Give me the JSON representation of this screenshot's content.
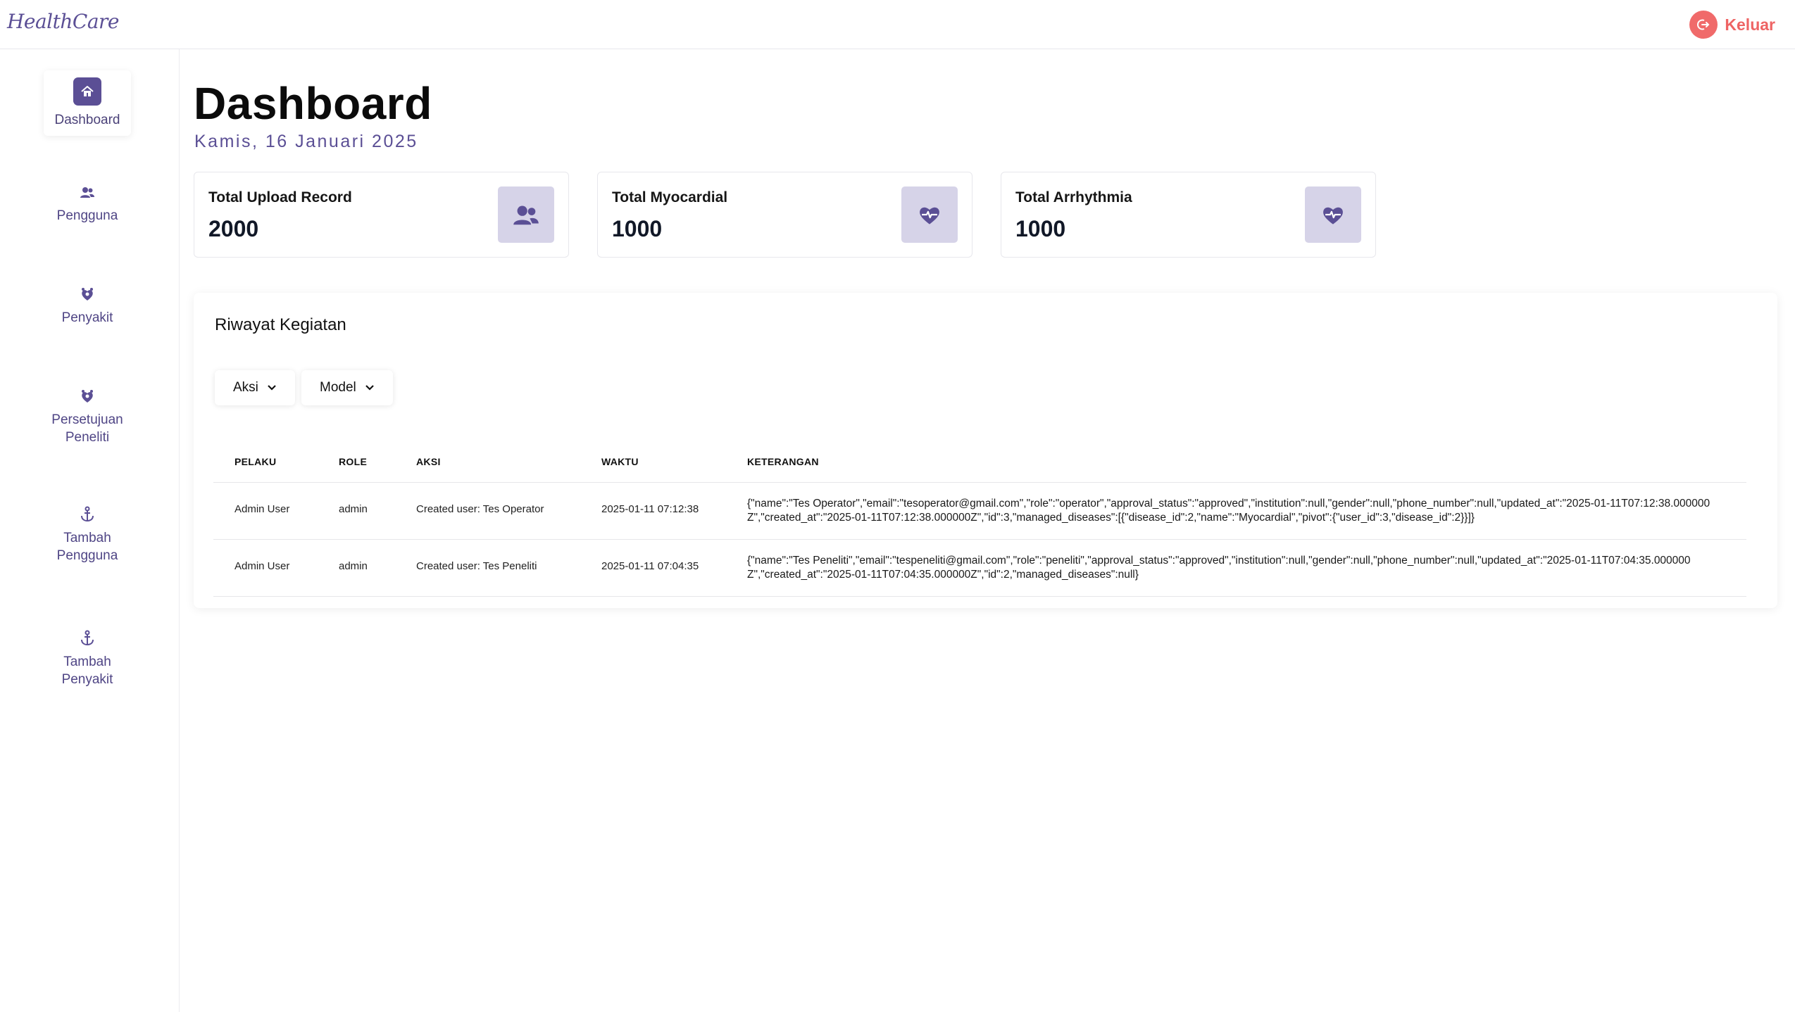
{
  "app": {
    "logo": "HealthCare",
    "logout_label": "Keluar"
  },
  "sidebar": {
    "items": [
      {
        "label": "Dashboard",
        "icon": "home-icon",
        "active": true
      },
      {
        "label": "Pengguna",
        "icon": "users-icon",
        "active": false
      },
      {
        "label": "Penyakit",
        "icon": "disease-icon",
        "active": false
      },
      {
        "label": "Persetujuan Peneliti",
        "icon": "disease-icon",
        "active": false
      },
      {
        "label": "Tambah Pengguna",
        "icon": "anchor-icon",
        "active": false
      },
      {
        "label": "Tambah Penyakit",
        "icon": "anchor-icon",
        "active": false
      }
    ]
  },
  "header": {
    "title": "Dashboard",
    "date": "Kamis, 16 Januari 2025"
  },
  "stats": [
    {
      "label": "Total Upload Record",
      "value": "2000",
      "icon": "users-icon"
    },
    {
      "label": "Total Myocardial",
      "value": "1000",
      "icon": "heart-pulse-icon"
    },
    {
      "label": "Total Arrhythmia",
      "value": "1000",
      "icon": "heart-pulse-icon"
    }
  ],
  "activity": {
    "title": "Riwayat Kegiatan",
    "filters": [
      {
        "label": "Aksi"
      },
      {
        "label": "Model"
      }
    ],
    "columns": [
      "PELAKU",
      "ROLE",
      "AKSI",
      "WAKTU",
      "KETERANGAN"
    ],
    "rows": [
      {
        "pelaku": "Admin User",
        "role": "admin",
        "aksi": "Created user: Tes Operator",
        "waktu": "2025-01-11 07:12:38",
        "keterangan": "{\"name\":\"Tes Operator\",\"email\":\"tesoperator@gmail.com\",\"role\":\"operator\",\"approval_status\":\"approved\",\"institution\":null,\"gender\":null,\"phone_number\":null,\"updated_at\":\"2025-01-11T07:12:38.000000Z\",\"created_at\":\"2025-01-11T07:12:38.000000Z\",\"id\":3,\"managed_diseases\":[{\"disease_id\":2,\"name\":\"Myocardial\",\"pivot\":{\"user_id\":3,\"disease_id\":2}}]}"
      },
      {
        "pelaku": "Admin User",
        "role": "admin",
        "aksi": "Created user: Tes Peneliti",
        "waktu": "2025-01-11 07:04:35",
        "keterangan": "{\"name\":\"Tes Peneliti\",\"email\":\"tespeneliti@gmail.com\",\"role\":\"peneliti\",\"approval_status\":\"approved\",\"institution\":null,\"gender\":null,\"phone_number\":null,\"updated_at\":\"2025-01-11T07:04:35.000000Z\",\"created_at\":\"2025-01-11T07:04:35.000000Z\",\"id\":2,\"managed_diseases\":null}"
      }
    ]
  },
  "colors": {
    "brand": "#5b4f95",
    "logout": "#ee6464",
    "icon_bg": "#d6d3e8"
  }
}
